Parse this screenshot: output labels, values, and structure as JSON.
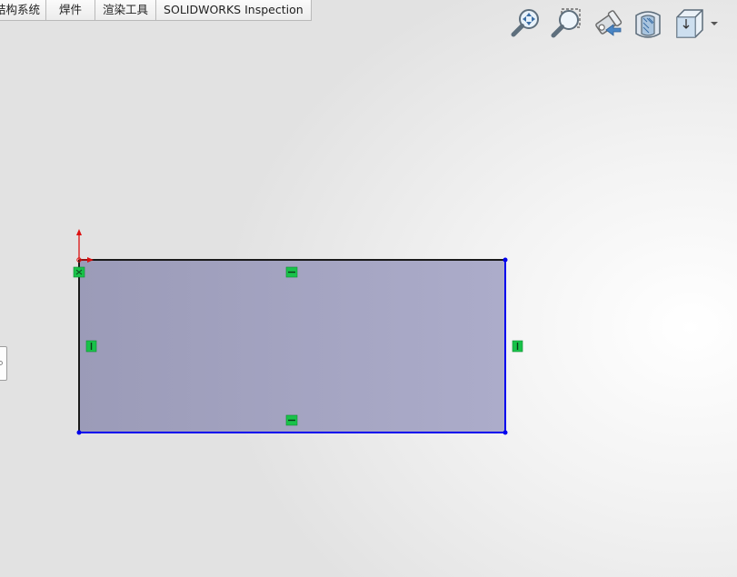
{
  "tabs": [
    {
      "label": "结构系统"
    },
    {
      "label": "焊件"
    },
    {
      "label": "渲染工具"
    },
    {
      "label": "SOLIDWORKS Inspection"
    }
  ],
  "view_toolbar": {
    "icons": [
      "zoom-to-fit-icon",
      "zoom-to-area-icon",
      "previous-view-icon",
      "section-view-icon",
      "view-orientation-icon"
    ]
  },
  "sketch": {
    "shape": "rectangle",
    "fill_color": "#a3a3c0",
    "top_edge_color": "#1a1a1a",
    "left_edge_color": "#1a1a1a",
    "right_edge_color": "#0000ee",
    "bottom_edge_color": "#0000ee",
    "relation_color": "#19c24a",
    "origin_color": "#dd1111",
    "relations": [
      "horizontal",
      "horizontal",
      "vertical",
      "vertical",
      "fix"
    ]
  }
}
